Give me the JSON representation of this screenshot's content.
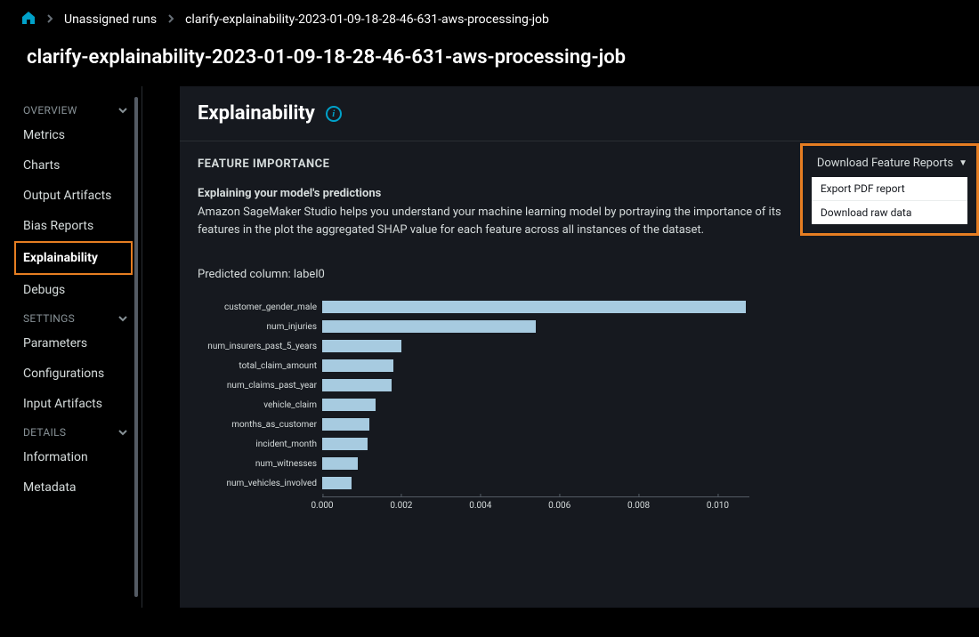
{
  "breadcrumb": {
    "unassigned_runs": "Unassigned runs",
    "job_name": "clarify-explainability-2023-01-09-18-28-46-631-aws-processing-job"
  },
  "page_title": "clarify-explainability-2023-01-09-18-28-46-631-aws-processing-job",
  "sidebar": {
    "sections": [
      {
        "label": "OVERVIEW",
        "items": [
          "Metrics",
          "Charts",
          "Output Artifacts",
          "Bias Reports",
          "Explainability",
          "Debugs"
        ],
        "active": "Explainability"
      },
      {
        "label": "SETTINGS",
        "items": [
          "Parameters",
          "Configurations",
          "Input Artifacts"
        ]
      },
      {
        "label": "DETAILS",
        "items": [
          "Information",
          "Metadata"
        ]
      }
    ]
  },
  "panel": {
    "title": "Explainability",
    "section_heading": "FEATURE IMPORTANCE",
    "subheading": "Explaining your model's predictions",
    "description": "Amazon SageMaker Studio helps you understand your machine learning model by portraying the importance of its features in the plot the aggregated SHAP value for each feature across all instances of the dataset.",
    "download_label": "Download Feature Reports",
    "download_options": [
      "Export PDF report",
      "Download raw data"
    ],
    "predicted_prefix": "Predicted column: ",
    "predicted_value": "label0"
  },
  "chart_data": {
    "type": "bar",
    "orientation": "horizontal",
    "title": "",
    "xlabel": "",
    "ylabel": "",
    "xlim": [
      0,
      0.0108
    ],
    "x_ticks": [
      "0.000",
      "0.002",
      "0.004",
      "0.006",
      "0.008",
      "0.010"
    ],
    "categories": [
      "customer_gender_male",
      "num_injuries",
      "num_insurers_past_5_years",
      "total_claim_amount",
      "num_claims_past_year",
      "vehicle_claim",
      "months_as_customer",
      "incident_month",
      "num_witnesses",
      "num_vehicles_involved"
    ],
    "values": [
      0.0107,
      0.0054,
      0.002,
      0.0018,
      0.00175,
      0.00135,
      0.0012,
      0.00115,
      0.0009,
      0.00075
    ]
  }
}
